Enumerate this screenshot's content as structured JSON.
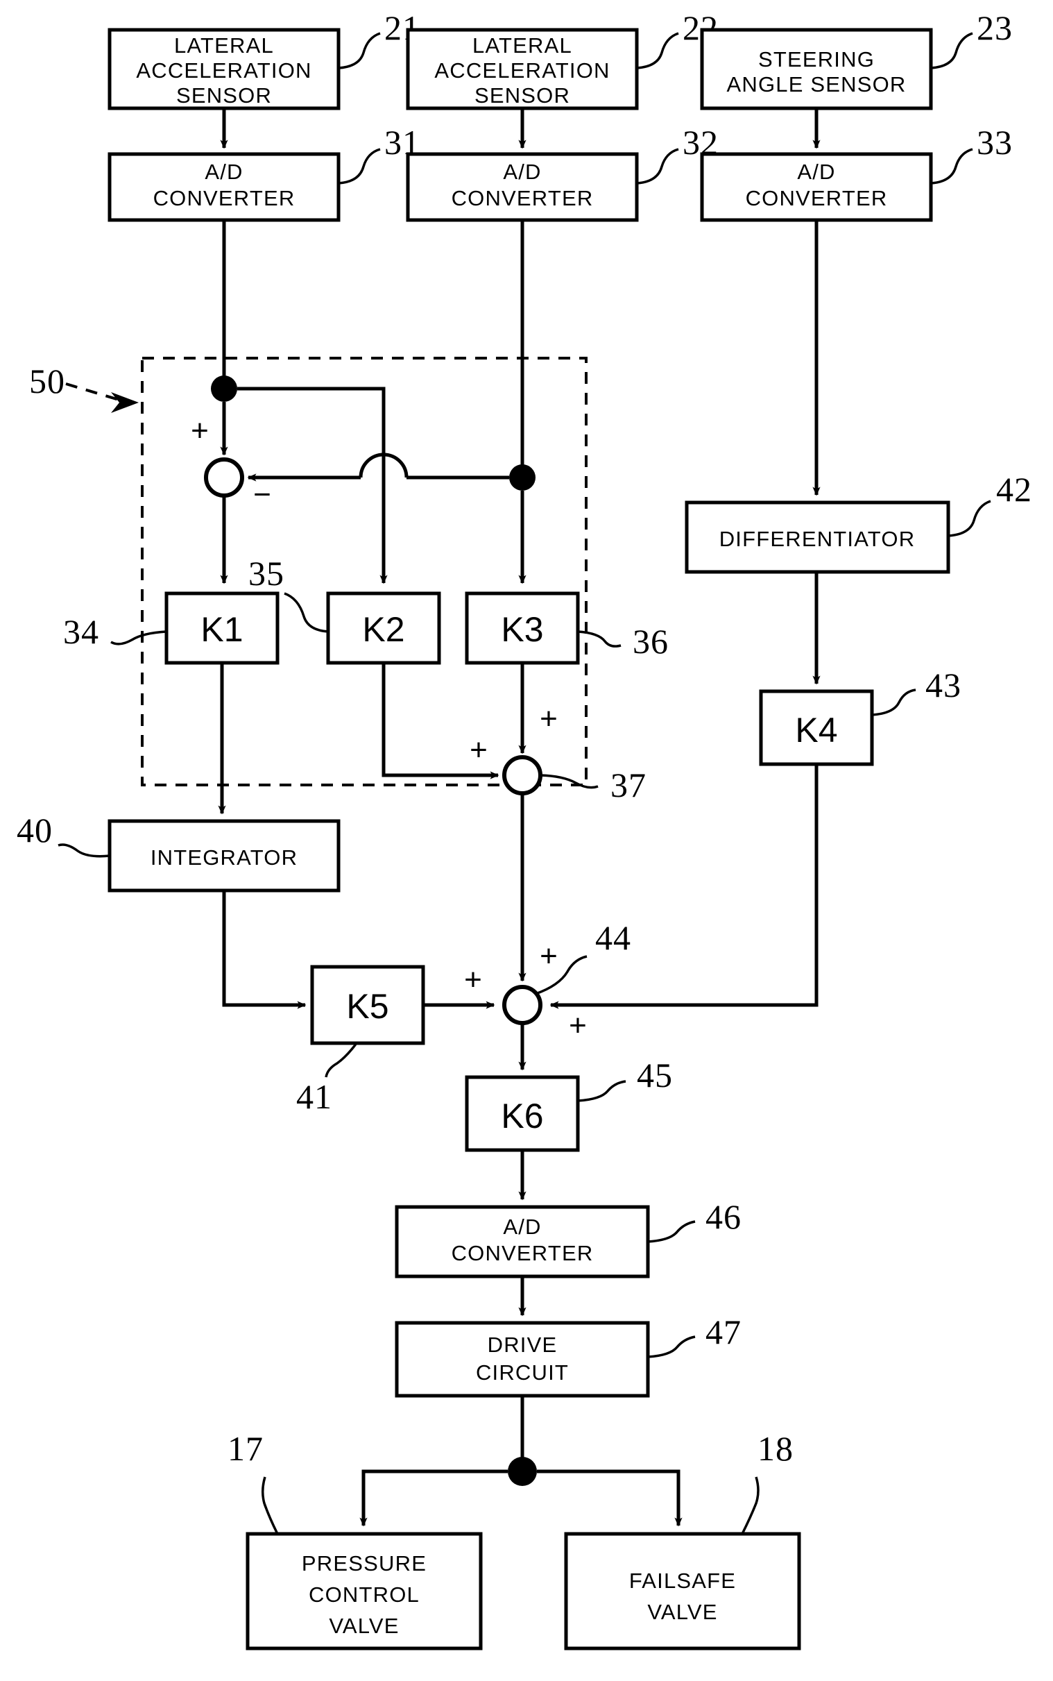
{
  "figure": {
    "type": "patent-block-diagram",
    "title": "",
    "background": "#ffffff",
    "ink": "#000000"
  },
  "blocks": [
    {
      "id": "b21",
      "label_lines": [
        "LATERAL",
        "ACCELERATION",
        "SENSOR"
      ],
      "ref": "21"
    },
    {
      "id": "b22",
      "label_lines": [
        "LATERAL",
        "ACCELERATION",
        "SENSOR"
      ],
      "ref": "22"
    },
    {
      "id": "b23",
      "label_lines": [
        "STEERING",
        "ANGLE SENSOR"
      ],
      "ref": "23"
    },
    {
      "id": "b31",
      "label_lines": [
        "A/D",
        "CONVERTER"
      ],
      "ref": "31"
    },
    {
      "id": "b32",
      "label_lines": [
        "A/D",
        "CONVERTER"
      ],
      "ref": "32"
    },
    {
      "id": "b33",
      "label_lines": [
        "A/D",
        "CONVERTER"
      ],
      "ref": "33"
    },
    {
      "id": "b34",
      "label_lines": [
        "K1"
      ],
      "ref": "34"
    },
    {
      "id": "b35",
      "label_lines": [
        "K2"
      ],
      "ref": "35"
    },
    {
      "id": "b36",
      "label_lines": [
        "K3"
      ],
      "ref": "36"
    },
    {
      "id": "b42",
      "label_lines": [
        "DIFFERENTIATOR"
      ],
      "ref": "42"
    },
    {
      "id": "b43",
      "label_lines": [
        "K4"
      ],
      "ref": "43"
    },
    {
      "id": "b40",
      "label_lines": [
        "INTEGRATOR"
      ],
      "ref": "40"
    },
    {
      "id": "b41",
      "label_lines": [
        "K5"
      ],
      "ref": "41"
    },
    {
      "id": "b45",
      "label_lines": [
        "K6"
      ],
      "ref": "45"
    },
    {
      "id": "b46",
      "label_lines": [
        "A/D",
        "CONVERTER"
      ],
      "ref": "46"
    },
    {
      "id": "b47",
      "label_lines": [
        "DRIVE",
        "CIRCUIT"
      ],
      "ref": "47"
    },
    {
      "id": "b17",
      "label_lines": [
        "PRESSURE",
        "CONTROL",
        "VALVE"
      ],
      "ref": "17"
    },
    {
      "id": "b18",
      "label_lines": [
        "FAILSAFE",
        "VALVE"
      ],
      "ref": "18"
    }
  ],
  "labels": {
    "b21_l1": "LATERAL",
    "b21_l2": "ACCELERATION",
    "b21_l3": "SENSOR",
    "b22_l1": "LATERAL",
    "b22_l2": "ACCELERATION",
    "b22_l3": "SENSOR",
    "b23_l1": "STEERING",
    "b23_l2": "ANGLE SENSOR",
    "b31_l1": "A/D",
    "b31_l2": "CONVERTER",
    "b32_l1": "A/D",
    "b32_l2": "CONVERTER",
    "b33_l1": "A/D",
    "b33_l2": "CONVERTER",
    "b34_l1": "K1",
    "b35_l1": "K2",
    "b36_l1": "K3",
    "b42_l1": "DIFFERENTIATOR",
    "b43_l1": "K4",
    "b40_l1": "INTEGRATOR",
    "b41_l1": "K5",
    "b45_l1": "K6",
    "b46_l1": "A/D",
    "b46_l2": "CONVERTER",
    "b47_l1": "DRIVE",
    "b47_l2": "CIRCUIT",
    "b17_l1": "PRESSURE",
    "b17_l2": "CONTROL",
    "b17_l3": "VALVE",
    "b18_l1": "FAILSAFE",
    "b18_l2": "VALVE"
  },
  "reference_numerals": {
    "n21": "21",
    "n22": "22",
    "n23": "23",
    "n31": "31",
    "n32": "32",
    "n33": "33",
    "n34": "34",
    "n35": "35",
    "n36": "36",
    "n37": "37",
    "n40": "40",
    "n41": "41",
    "n42": "42",
    "n43": "43",
    "n44": "44",
    "n45": "45",
    "n46": "46",
    "n47": "47",
    "n50": "50",
    "n17": "17",
    "n18": "18"
  },
  "summing_junctions": [
    {
      "id": "s34",
      "ref": "",
      "signs": [
        {
          "text": "+",
          "pos": "top-left"
        },
        {
          "text": "−",
          "pos": "right-below"
        }
      ]
    },
    {
      "id": "s37",
      "ref": "37",
      "signs": [
        {
          "text": "+",
          "pos": "top-right"
        },
        {
          "text": "+",
          "pos": "left-top"
        }
      ]
    },
    {
      "id": "s44",
      "ref": "44",
      "signs": [
        {
          "text": "+",
          "pos": "top-right"
        },
        {
          "text": "+",
          "pos": "left-top"
        },
        {
          "text": "+",
          "pos": "right-below"
        }
      ]
    }
  ],
  "signs": {
    "s34_plus": "+",
    "s34_minus": "−",
    "s37_plus_top": "+",
    "s37_plus_left": "+",
    "s44_plus_top": "+",
    "s44_plus_left": "+",
    "s44_plus_right": "+"
  },
  "dashed_group": {
    "ref": "50",
    "description": "dashed enclosure around summing and K1 K2 K3 stage"
  }
}
